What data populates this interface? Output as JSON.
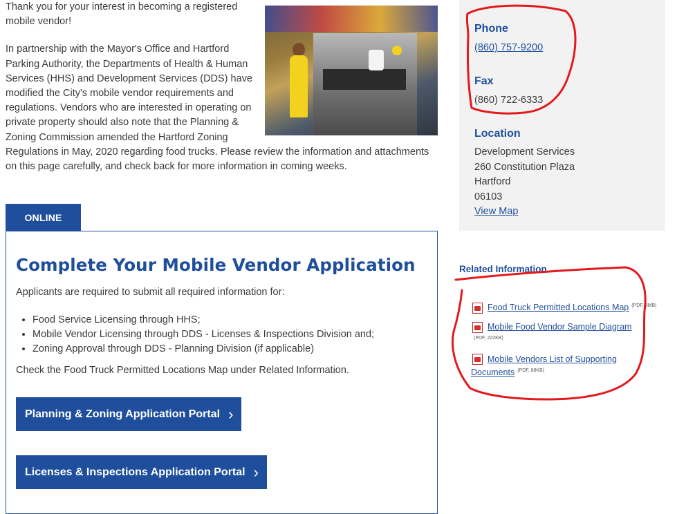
{
  "intro": {
    "p1": "Thank you for your interest in becoming a registered mobile vendor!",
    "p2": "In partnership with the Mayor's Office and Hartford Parking Authority, the Departments of Health & Human Services (HHS) and Development Services (DDS) have modified the City's mobile vendor requirements and regulations. Vendors who are interested in operating on private property should also note that the Planning & Zoning Commission amended the Hartford Zoning Regulations in May, 2020 regarding food trucks. Please review the information and attachments on this page carefully, and check back for more information in coming weeks."
  },
  "tab": {
    "label": "ONLINE"
  },
  "card": {
    "title": "Complete Your Mobile Vendor Application",
    "lead": "Applicants are required to submit all required information for:",
    "items": [
      "Food Service Licensing through HHS;",
      "Mobile Vendor Licensing through DDS - Licenses & Inspections Division and;",
      "Zoning Approval through DDS - Planning Division (if applicable)"
    ],
    "check": "Check the Food Truck Permitted Locations Map under Related Information.",
    "btn_pz": "Planning & Zoning Application Portal",
    "btn_li": "Licenses & Inspections Application Portal",
    "chevron": "›"
  },
  "contact": {
    "phone_label": "Phone",
    "phone": "(860) 757-9200",
    "fax_label": "Fax",
    "fax": "(860) 722-6333",
    "location_label": "Location",
    "loc": [
      "Development Services",
      "260 Constitution Plaza",
      "Hartford",
      "06103"
    ],
    "map_link": "View Map"
  },
  "related": {
    "title": "Related Information",
    "items": [
      {
        "label": "Food Truck Permitted Locations Map",
        "meta": "(PDF, 8MB)"
      },
      {
        "label": "Mobile Food Vendor Sample Diagram",
        "meta": "(PDF, 222KB)"
      },
      {
        "label_1": "Mobile Vendors List of Supporting",
        "label_2": "Documents",
        "meta": "(PDF, 88KB)"
      }
    ]
  },
  "colors": {
    "accent": "#1f4e9c",
    "panel": "#f2f2f2",
    "annotation": "#e3191c"
  },
  "icons": [
    "pdf-icon",
    "chevron-right-icon"
  ]
}
